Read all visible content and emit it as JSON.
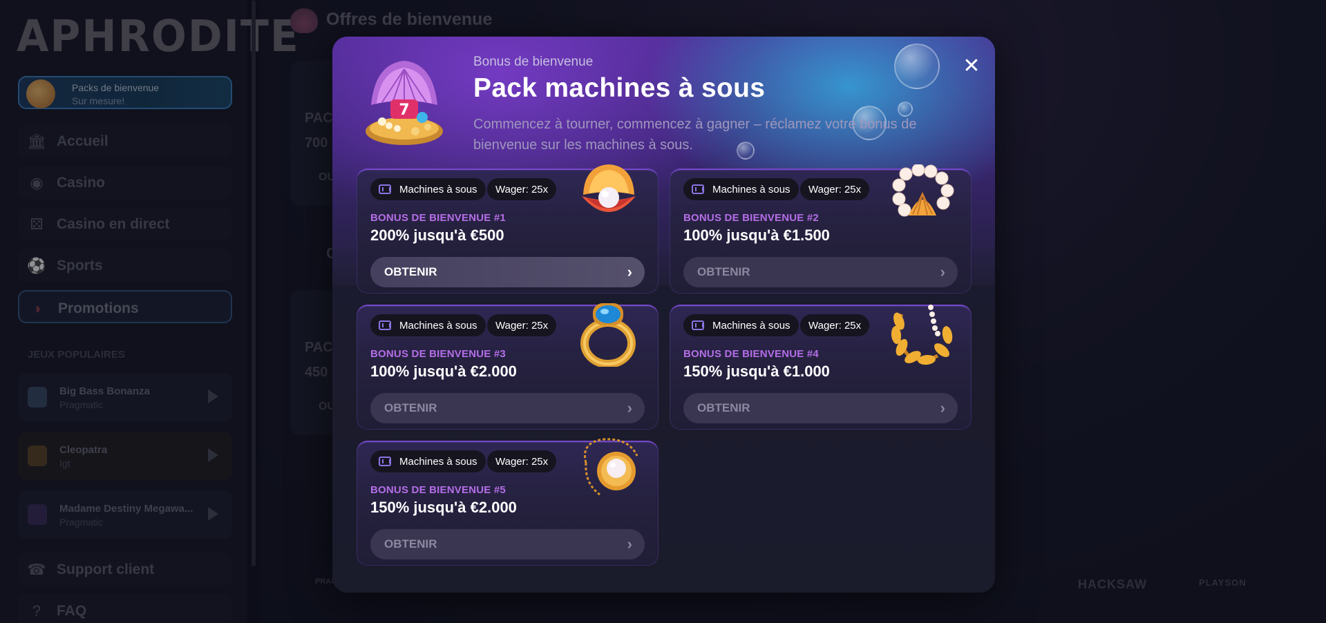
{
  "sidebar": {
    "logo": "APHRODITE",
    "promo_card": {
      "line1": "Packs de bienvenue",
      "line2": "Sur mesure!"
    },
    "nav": [
      {
        "label": "Accueil",
        "icon": "bank-icon"
      },
      {
        "label": "Casino",
        "icon": "chip-icon"
      },
      {
        "label": "Casino en direct",
        "icon": "dice-icon"
      },
      {
        "label": "Sports",
        "icon": "soccer-ball-icon"
      },
      {
        "label": "Promotions",
        "icon": "watermelon-icon"
      }
    ],
    "section_label": "JEUX POPULAIRES",
    "games": [
      {
        "name": "Big Bass Bonanza",
        "provider": "Pragmatic"
      },
      {
        "name": "Cleopatra",
        "provider": "Igt"
      },
      {
        "name": "Madame Destiny Megawa...",
        "provider": "Pragmatic"
      }
    ],
    "bottom_nav": [
      {
        "label": "Support client",
        "icon": "headset-icon"
      },
      {
        "label": "FAQ",
        "icon": "help-icon"
      }
    ]
  },
  "background": {
    "heading": "Offres de bienvenue",
    "card_texts": [
      "PAC",
      "700",
      "OU",
      "C",
      "PAC",
      "450",
      "OU"
    ],
    "partners": [
      "PRAG",
      "HACKSAW",
      "PLAYSON"
    ]
  },
  "modal": {
    "subtitle": "Bonus de bienvenue",
    "title": "Pack machines à sous",
    "description": "Commencez à tourner, commencez à gagner – réclamez votre bonus de bienvenue sur les machines à sous.",
    "close_label": "✕",
    "bonuses": [
      {
        "category": "Machines à sous",
        "wager": "Wager: 25x",
        "label": "BONUS DE BIENVENUE #1",
        "offer": "200% jusqu'à €500",
        "cta": "OBTENIR",
        "art": "pearl-shell-icon"
      },
      {
        "category": "Machines à sous",
        "wager": "Wager: 25x",
        "label": "BONUS DE BIENVENUE #2",
        "offer": "100% jusqu'à €1.500",
        "cta": "OBTENIR",
        "art": "pearl-bracelet-icon"
      },
      {
        "category": "Machines à sous",
        "wager": "Wager: 25x",
        "label": "BONUS DE BIENVENUE #3",
        "offer": "100% jusqu'à €2.000",
        "cta": "OBTENIR",
        "art": "sapphire-ring-icon"
      },
      {
        "category": "Machines à sous",
        "wager": "Wager: 25x",
        "label": "BONUS DE BIENVENUE #4",
        "offer": "150% jusqu'à €1.000",
        "cta": "OBTENIR",
        "art": "laurel-wreath-icon"
      },
      {
        "category": "Machines à sous",
        "wager": "Wager: 25x",
        "label": "BONUS DE BIENVENUE #5",
        "offer": "150% jusqu'à €2.000",
        "cta": "OBTENIR",
        "art": "pearl-pendant-icon"
      }
    ]
  },
  "colors": {
    "accent_purple": "#7547c9",
    "bonus_label": "#b56ee8",
    "modal_bg": "#1a1b2e"
  }
}
